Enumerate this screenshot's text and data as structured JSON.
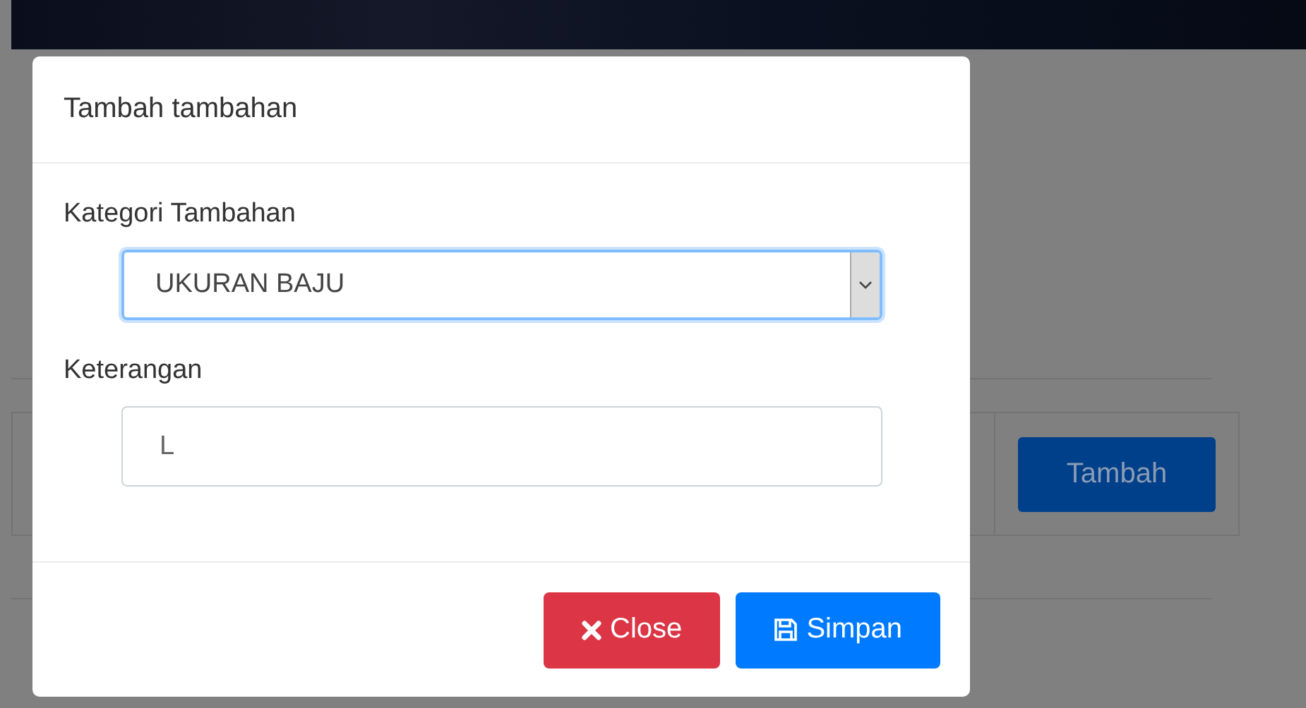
{
  "background": {
    "action_button": "Tambah"
  },
  "modal": {
    "title": "Tambah tambahan",
    "fields": [
      {
        "kind": "select",
        "label": "Kategori Tambahan",
        "value": "UKURAN BAJU"
      },
      {
        "kind": "input",
        "label": "Keterangan",
        "value": "L"
      }
    ],
    "buttons": [
      {
        "kind": "danger",
        "label": "Close"
      },
      {
        "kind": "primary",
        "label": "Simpan"
      }
    ]
  }
}
